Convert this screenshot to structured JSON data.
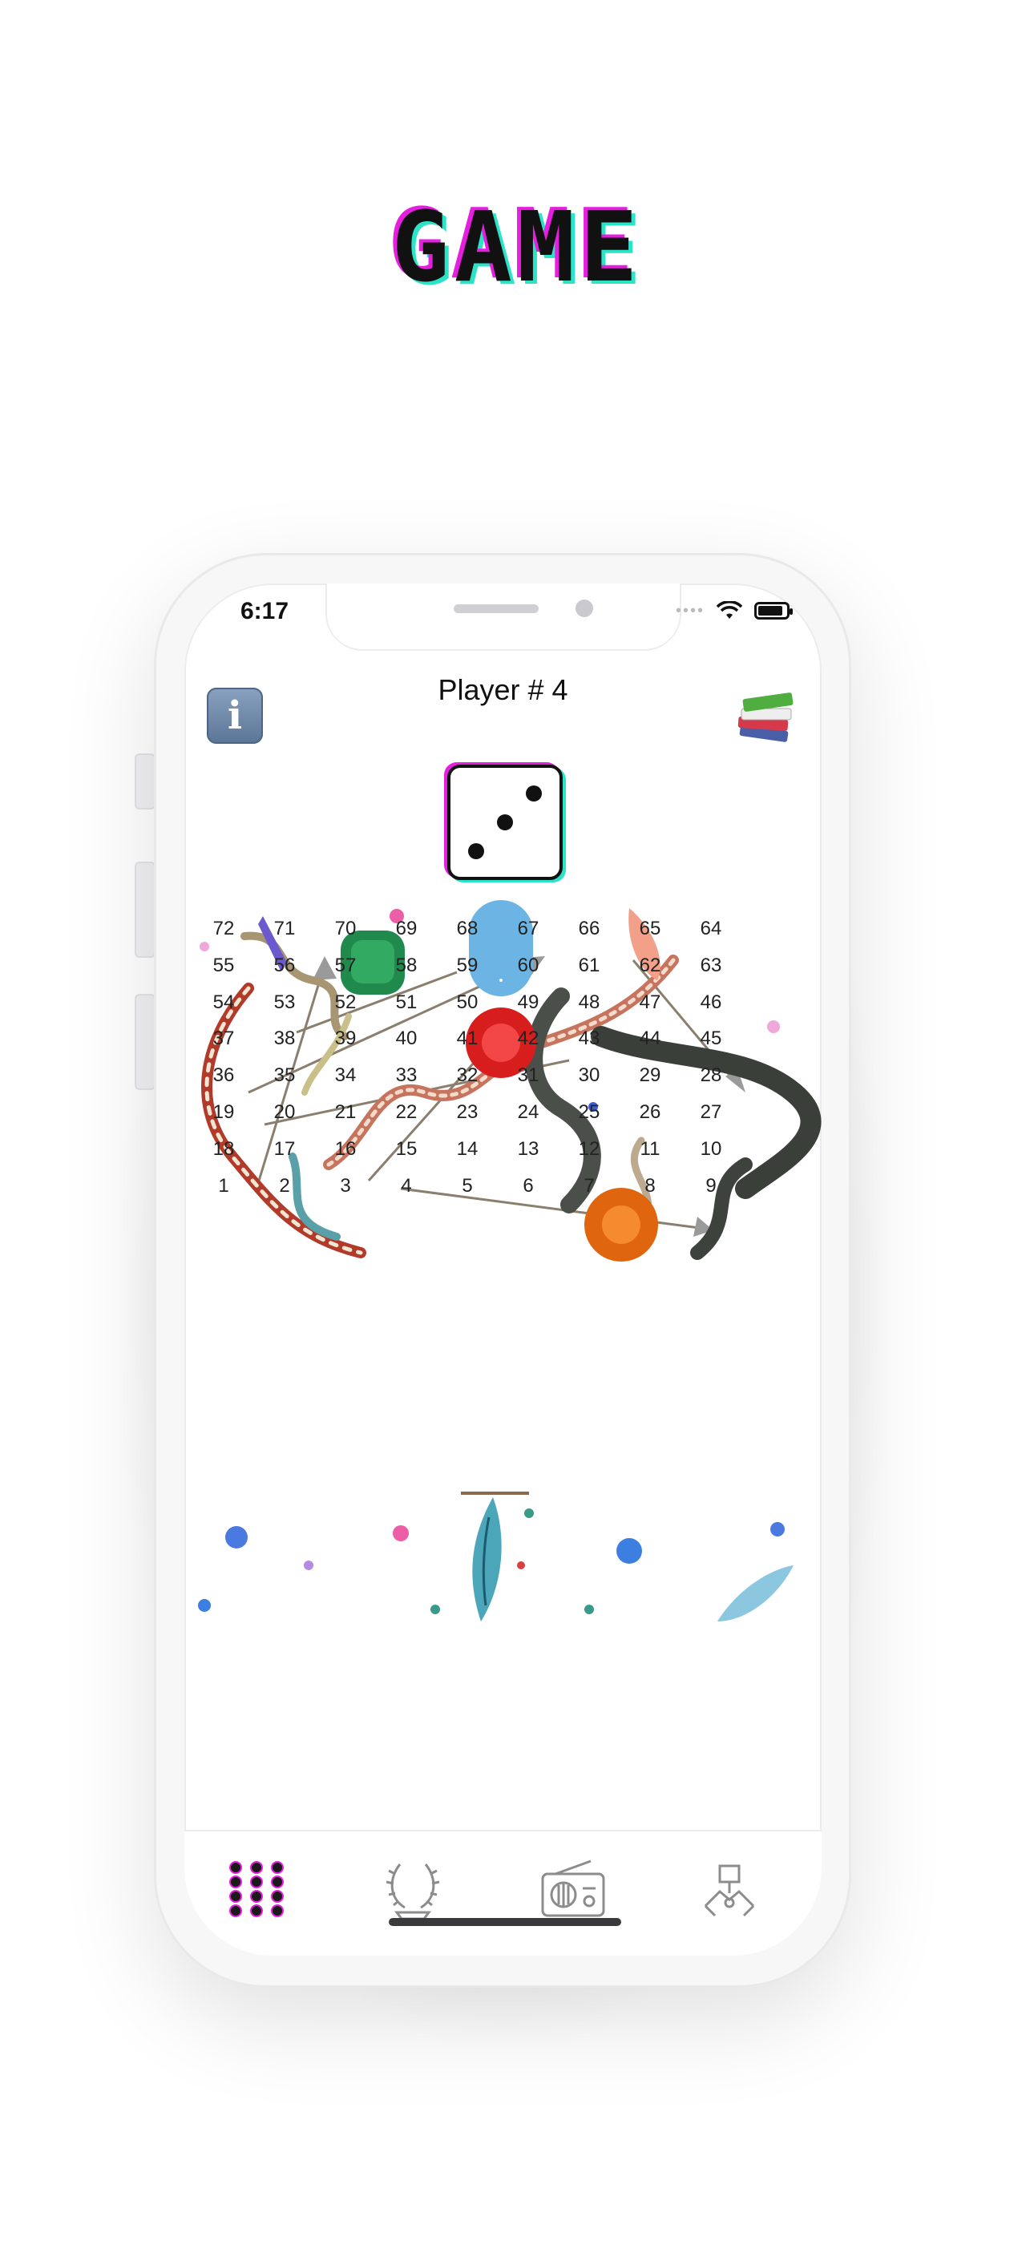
{
  "promo": {
    "title": "GAME"
  },
  "status_bar": {
    "time": "6:17"
  },
  "header": {
    "title": "Player # 4",
    "info_label": "i"
  },
  "dice": {
    "value": 3
  },
  "board": {
    "rows": [
      [
        "72",
        "71",
        "70",
        "69",
        "68",
        "67",
        "66",
        "65",
        "64"
      ],
      [
        "55",
        "56",
        "57",
        "58",
        "59",
        "60",
        "61",
        "62",
        "63"
      ],
      [
        "54",
        "53",
        "52",
        "51",
        "50",
        "49",
        "48",
        "47",
        "46"
      ],
      [
        "37",
        "38",
        "39",
        "40",
        "41",
        "42",
        "43",
        "44",
        "45"
      ],
      [
        "36",
        "35",
        "34",
        "33",
        "32",
        "31",
        "30",
        "29",
        "28"
      ],
      [
        "19",
        "20",
        "21",
        "22",
        "23",
        "24",
        "25",
        "26",
        "27"
      ],
      [
        "18",
        "17",
        "16",
        "15",
        "14",
        "13",
        "12",
        "11",
        "10"
      ],
      [
        "1",
        "2",
        "3",
        "4",
        "5",
        "6",
        "7",
        "8",
        "9"
      ]
    ]
  },
  "tabs": [
    {
      "name": "tab-game",
      "icon": "grid-icon",
      "active": true
    },
    {
      "name": "tab-awards",
      "icon": "laurel-icon",
      "active": false
    },
    {
      "name": "tab-radio",
      "icon": "radio-icon",
      "active": false
    },
    {
      "name": "tab-community",
      "icon": "hands-icon",
      "active": false
    }
  ],
  "colors": {
    "accent_pink": "#e61ee0",
    "accent_teal": "#2be3c6"
  }
}
